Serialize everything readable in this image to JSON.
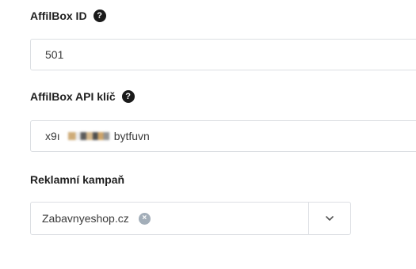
{
  "affilbox_id": {
    "label": "AffilBox ID",
    "help_glyph": "?",
    "value": "501"
  },
  "affilbox_api_key": {
    "label": "AffilBox API klíč",
    "help_glyph": "?",
    "value_prefix": "x9ı",
    "value_suffix": "bytfuvn"
  },
  "campaign": {
    "label": "Reklamní kampaň",
    "selected": "Zabavnyeshop.cz",
    "clear_glyph": "×"
  },
  "colors": {
    "border": "#dcdfe3",
    "label_text": "#1f1f1f",
    "help_icon_bg": "#1a1a1a",
    "clear_icon_bg": "#a3aeb9"
  }
}
